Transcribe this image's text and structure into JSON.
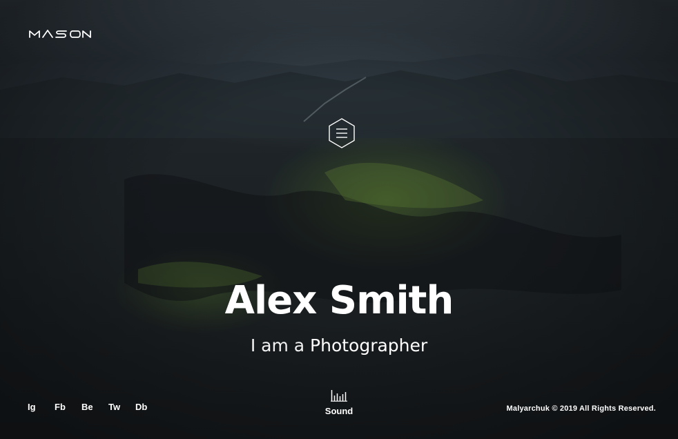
{
  "brand": {
    "logo_text": "MASON"
  },
  "hero": {
    "name": "Alex Smith",
    "subtitle_prefix": "I am a",
    "subtitle_role": "Photographer"
  },
  "menu": {
    "icon": "hamburger-hexagon-icon"
  },
  "social": [
    {
      "label": "Ig"
    },
    {
      "label": "Fb"
    },
    {
      "label": "Be"
    },
    {
      "label": "Tw"
    },
    {
      "label": "Db"
    }
  ],
  "sound": {
    "label": "Sound",
    "icon": "sound-bars-icon"
  },
  "footer": {
    "copyright": "Malyarchuk © 2019 All Rights Reserved."
  },
  "colors": {
    "text": "#ffffff",
    "background": "#161a1d",
    "accent_green": "#4e6e28"
  }
}
